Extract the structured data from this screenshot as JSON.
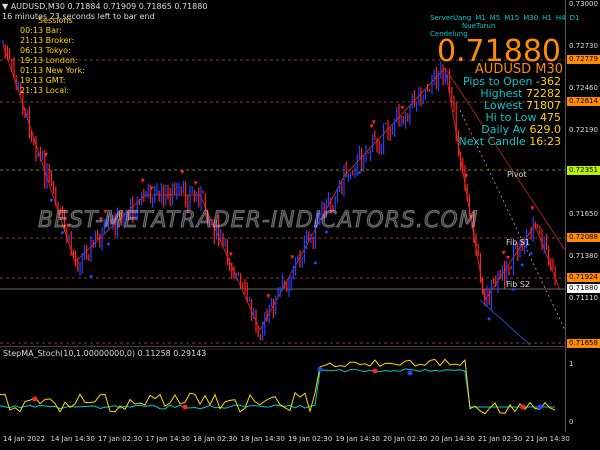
{
  "header": {
    "symbol_line": "AUDUSD,M30  0.71884 0.71909 0.71865 0.71880",
    "countdown": "16 minutes 23 seconds left to bar end"
  },
  "sessions": {
    "title": "Sessions",
    "items": [
      {
        "time": "00:13",
        "label": "Bar:"
      },
      {
        "time": "21:13",
        "label": "Broker:"
      },
      {
        "time": "06:13",
        "label": "Tokyo:"
      },
      {
        "time": "19:13",
        "label": "London:"
      },
      {
        "time": "01:13",
        "label": "New York:"
      },
      {
        "time": "19:13",
        "label": "GMT:"
      },
      {
        "time": "21:13",
        "label": "Local:"
      }
    ]
  },
  "dashboard": {
    "timeframes": [
      "ServerUang",
      "M1",
      "M5",
      "M15",
      "M30",
      "H1",
      "H4",
      "D1"
    ],
    "subline1": "NueTurun",
    "subline2": "Cendelung",
    "big_price": "0.71880",
    "pair": "AUDUSD M30",
    "rows": [
      {
        "label": "Pips to Open",
        "value": "-362"
      },
      {
        "label": "Highest",
        "value": "72282"
      },
      {
        "label": "Lowest",
        "value": "71807"
      },
      {
        "label": "Hi to Low",
        "value": "475"
      },
      {
        "label": "Daily Av",
        "value": "629.0"
      },
      {
        "label": "Next Candle",
        "value": "16:23"
      }
    ]
  },
  "levels": {
    "pivot": "Pivot",
    "s1": "Fib S1",
    "s2": "Fib S2"
  },
  "watermark": "BEST-METATRADER-INDICATORS.COM",
  "price_axis": {
    "ticks": [
      "0.73000",
      "0.72730",
      "0.72460",
      "0.72190",
      "0.71920",
      "0.71650",
      "0.71380",
      "0.71110"
    ],
    "labels": [
      {
        "text": "0.72779",
        "color": "#ff8c00"
      },
      {
        "text": "0.72614",
        "color": "#ff8c00"
      },
      {
        "text": "0.72351",
        "color": "#b8f000"
      },
      {
        "text": "0.72088",
        "color": "#ff8c00"
      },
      {
        "text": "0.71924",
        "color": "#ff8c00"
      },
      {
        "text": "0.71880",
        "color": "#ffffff"
      },
      {
        "text": "0.71658",
        "color": "#ff8c00"
      }
    ]
  },
  "sub_window": {
    "title": "StepMA_Stoch(10,1.00000000,0) 0.11258 0.29143",
    "ticks": [
      "1",
      "0"
    ]
  },
  "time_axis": [
    "14 Jan 2022",
    "14 Jan 14:30",
    "17 Jan 02:30",
    "17 Jan 14:30",
    "18 Jan 02:30",
    "18 Jan 14:30",
    "19 Jan 02:30",
    "19 Jan 14:30",
    "20 Jan 02:30",
    "20 Jan 14:30",
    "21 Jan 02:30",
    "21 Jan 14:30"
  ],
  "colors": {
    "bull": "#2244ff",
    "bear": "#ff2222",
    "axis": "#dddddd",
    "yellow": "#ffd700",
    "cyan": "#00c8c8",
    "orange": "#ff8c00"
  }
}
